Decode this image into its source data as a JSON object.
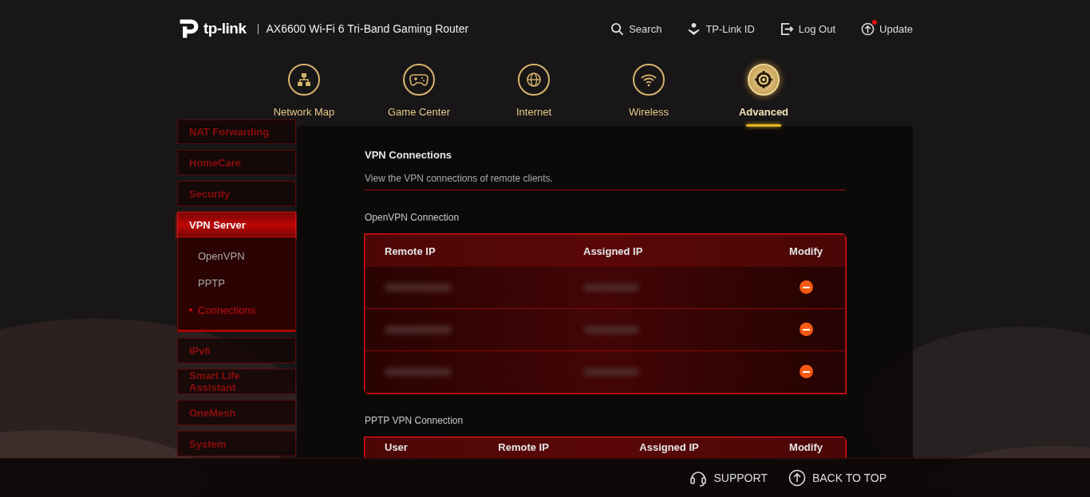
{
  "header": {
    "brand": "tp-link",
    "model": "AX6600 Wi-Fi 6 Tri-Band Gaming Router",
    "actions": [
      {
        "kind": "search",
        "label": "Search",
        "badge": false
      },
      {
        "kind": "id",
        "label": "TP-Link ID",
        "badge": false
      },
      {
        "kind": "logout",
        "label": "Log Out",
        "badge": false
      },
      {
        "kind": "update",
        "label": "Update",
        "badge": true
      }
    ]
  },
  "nav": [
    {
      "kind": "map",
      "label": "Network Map",
      "selected": false
    },
    {
      "kind": "game",
      "label": "Game Center",
      "selected": false
    },
    {
      "kind": "internet",
      "label": "Internet",
      "selected": false
    },
    {
      "kind": "wireless",
      "label": "Wireless",
      "selected": false
    },
    {
      "kind": "advanced",
      "label": "Advanced",
      "selected": true
    }
  ],
  "sidebar": {
    "items": [
      {
        "label": "NAT Forwarding",
        "selected": false
      },
      {
        "label": "HomeCare",
        "selected": false
      },
      {
        "label": "Security",
        "selected": false
      },
      {
        "label": "VPN Server",
        "selected": true,
        "expanded": true,
        "children": [
          {
            "label": "OpenVPN",
            "selected": false
          },
          {
            "label": "PPTP",
            "selected": false
          },
          {
            "label": "Connections",
            "selected": true
          }
        ]
      },
      {
        "label": "IPv6",
        "selected": false
      },
      {
        "label": "Smart Life Assistant",
        "selected": false
      },
      {
        "label": "OneMesh",
        "selected": false
      },
      {
        "label": "System",
        "selected": false
      }
    ]
  },
  "content": {
    "title": "VPN Connections",
    "description": "View the VPN connections of remote clients.",
    "openvpn": {
      "title": "OpenVPN Connection",
      "columns": [
        "Remote IP",
        "Assigned IP",
        "Modify"
      ],
      "rows": [
        {
          "redacted": true
        },
        {
          "redacted": true
        },
        {
          "redacted": true
        }
      ]
    },
    "pptp": {
      "title": "PPTP VPN Connection",
      "columns": [
        "User",
        "Remote IP",
        "Assigned IP",
        "Modify"
      ]
    }
  },
  "footer": {
    "links": [
      {
        "kind": "support",
        "label": "SUPPORT"
      },
      {
        "kind": "top",
        "label": "BACK TO TOP"
      }
    ]
  }
}
